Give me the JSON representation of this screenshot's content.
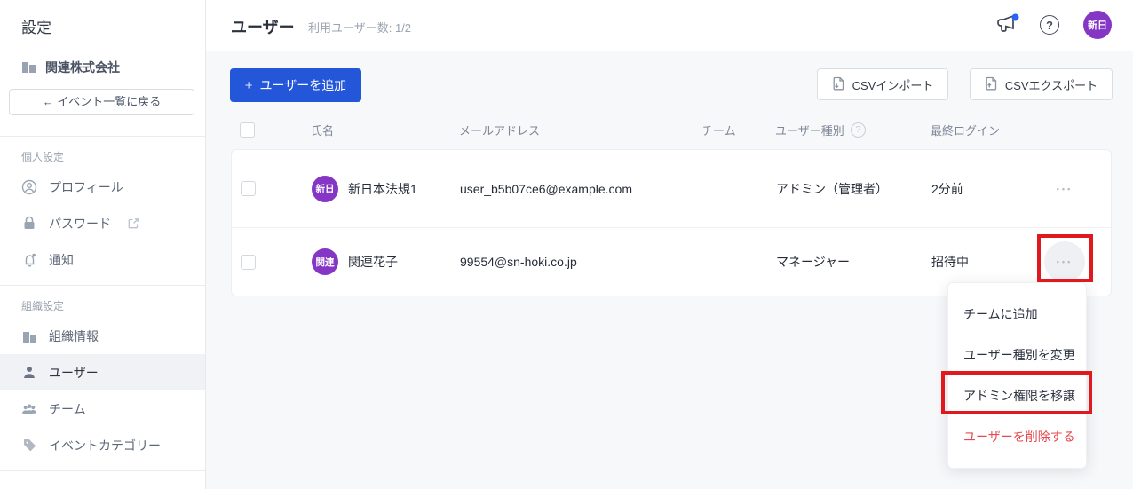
{
  "app": {
    "title": "設定"
  },
  "sidebar": {
    "company": {
      "name": "関連株式会社"
    },
    "back_button": {
      "label": "← イベント一覧に戻る"
    },
    "sections": [
      {
        "label": "個人設定",
        "items": [
          {
            "label": "プロフィール"
          },
          {
            "label": "パスワード"
          },
          {
            "label": "通知"
          }
        ]
      },
      {
        "label": "組織設定",
        "items": [
          {
            "label": "組織情報"
          },
          {
            "label": "ユーザー"
          },
          {
            "label": "チーム"
          },
          {
            "label": "イベントカテゴリー"
          }
        ]
      }
    ]
  },
  "header": {
    "title": "ユーザー",
    "subtitle": "利用ユーザー数: 1/2",
    "help_glyph": "?",
    "avatar": "新日"
  },
  "toolbar": {
    "add_user_plus": "+",
    "add_user_label": "ユーザーを追加",
    "csv_import": "CSVインポート",
    "csv_export": "CSVエクスポート"
  },
  "table": {
    "columns": [
      "氏名",
      "メールアドレス",
      "チーム",
      "ユーザー種別",
      "最終ログイン"
    ],
    "type_help_glyph": "?",
    "ellipsis_glyph": "•••",
    "rows": [
      {
        "avatar": "新日",
        "name": "新日本法規1",
        "email": "user_b5b07ce6@example.com",
        "team": "",
        "type": "アドミン（管理者）",
        "last_login": "2分前"
      },
      {
        "avatar": "関連",
        "name": "関連花子",
        "email": "99554@sn-hoki.co.jp",
        "team": "",
        "type": "マネージャー",
        "last_login": "招待中"
      }
    ]
  },
  "menu": {
    "items": [
      {
        "label": "チームに追加"
      },
      {
        "label": "ユーザー種別を変更"
      },
      {
        "label": "アドミン権限を移譲"
      },
      {
        "label": "ユーザーを削除する"
      }
    ]
  },
  "colors": {
    "accent_blue": "#2356d9",
    "avatar_purple": "#8536c4",
    "annotation_red": "#e0191f",
    "danger_red": "#e5494d",
    "notification_blue": "#2b63f6"
  }
}
